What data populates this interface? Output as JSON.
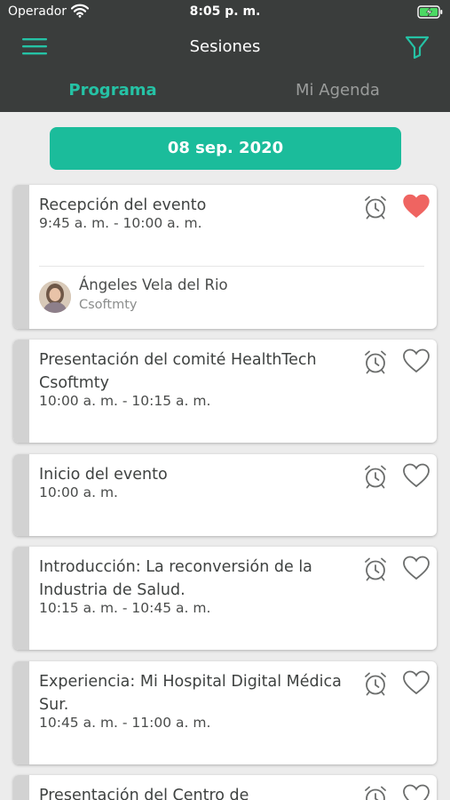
{
  "status_bar": {
    "carrier": "Operador",
    "time": "8:05 p. m."
  },
  "nav": {
    "title": "Sesiones"
  },
  "tabs": [
    {
      "label": "Programa",
      "active": true
    },
    {
      "label": "Mi Agenda",
      "active": false
    }
  ],
  "date_label": "08 sep. 2020",
  "sessions": [
    {
      "title": "Recepción del evento",
      "time": "9:45 a. m. - 10:00 a. m.",
      "favorite": true,
      "speaker": {
        "name": "Ángeles Vela del Rio",
        "company": "Csoftmty"
      }
    },
    {
      "title": "Presentación del comité HealthTech Csoftmty",
      "time": "10:00 a. m. - 10:15 a. m.",
      "favorite": false
    },
    {
      "title": "Inicio del evento",
      "time": "10:00 a. m.",
      "favorite": false
    },
    {
      "title": "Introducción: La reconversión de la Industria de Salud.",
      "time": "10:15 a. m. - 10:45 a. m.",
      "favorite": false
    },
    {
      "title": "Experiencia: Mi Hospital Digital Médica Sur.",
      "time": "10:45 a. m. - 11:00 a. m.",
      "favorite": false
    },
    {
      "title": "Presentación del Centro de",
      "time": "",
      "favorite": false
    }
  ],
  "colors": {
    "accent": "#1bbc9b",
    "header": "#3a3d3c",
    "favorite": "#ef6461",
    "stripe": "#d2d2d2"
  }
}
